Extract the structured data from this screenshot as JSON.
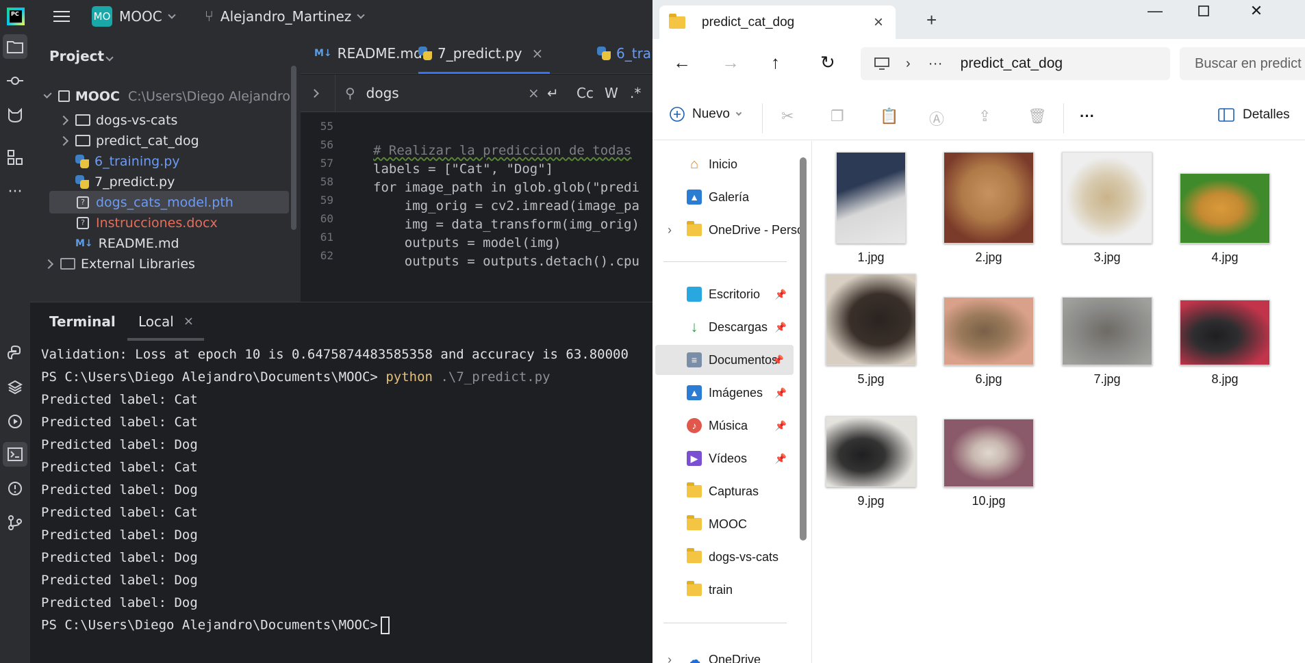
{
  "ide": {
    "project_badge": "MO",
    "project_name": "MOOC",
    "branch": "Alejandro_Martinez",
    "panel_title": "Project",
    "tree": [
      {
        "label": "MOOC",
        "path": "C:\\Users\\Diego Alejandro",
        "type": "folder-open"
      },
      {
        "label": "dogs-vs-cats",
        "type": "folder"
      },
      {
        "label": "predict_cat_dog",
        "type": "folder"
      },
      {
        "label": "6_training.py",
        "type": "py"
      },
      {
        "label": "7_predict.py",
        "type": "py"
      },
      {
        "label": "dogs_cats_model.pth",
        "type": "unknown"
      },
      {
        "label": "Instrucciones.docx",
        "type": "unknown"
      },
      {
        "label": "README.md",
        "type": "md"
      },
      {
        "label": "External Libraries",
        "type": "lib"
      }
    ],
    "editor_tabs": [
      {
        "icon": "M↓",
        "label": "README.md"
      },
      {
        "label": "7_predict.py"
      },
      {
        "label": "6_tra"
      }
    ],
    "search_query": "dogs",
    "search_options": [
      "Cc",
      "W",
      ".*"
    ],
    "code_lines": [
      {
        "n": "55",
        "text": ""
      },
      {
        "n": "56",
        "text": "# Realizar la prediccion de todas"
      },
      {
        "n": "57",
        "text": "labels = [\"Cat\", \"Dog\"]"
      },
      {
        "n": "58",
        "text": "for image_path in glob.glob(\"predi"
      },
      {
        "n": "59",
        "text": "    img_orig = cv2.imread(image_pa"
      },
      {
        "n": "60",
        "text": "    img = data_transform(img_orig)"
      },
      {
        "n": "61",
        "text": "    outputs = model(img)"
      },
      {
        "n": "62",
        "text": "    outputs = outputs.detach().cpu"
      }
    ],
    "terminal": {
      "title": "Terminal",
      "tab": "Local",
      "validation_line": "Validation: Loss at epoch 10 is 0.6475874483585358 and accuracy is 63.80000",
      "prompt": "PS C:\\Users\\Diego Alejandro\\Documents\\MOOC>",
      "command": "python",
      "command_arg": ".\\7_predict.py",
      "outputs": [
        "Predicted label: Cat",
        "Predicted label: Cat",
        "Predicted label: Dog",
        "Predicted label: Cat",
        "Predicted label: Dog",
        "Predicted label: Cat",
        "Predicted label: Dog",
        "Predicted label: Dog",
        "Predicted label: Dog",
        "Predicted label: Dog"
      ],
      "final_prompt": "PS C:\\Users\\Diego Alejandro\\Documents\\MOOC>"
    }
  },
  "explorer": {
    "tab_title": "predict_cat_dog",
    "address": "predict_cat_dog",
    "address_more": "···",
    "search_placeholder": "Buscar en predict",
    "new_label": "Nuevo",
    "details_label": "Detalles",
    "nav": [
      {
        "label": "Inicio",
        "icon": "home-icon",
        "color": "#e67e22"
      },
      {
        "label": "Galería",
        "icon": "gallery-icon",
        "color": "#2b7cd3"
      },
      {
        "label": "OneDrive - Perso",
        "icon": "folder-icon",
        "color": "#f4c542"
      },
      {
        "label": "Escritorio",
        "icon": "desktop-icon",
        "color": "#29a8e0"
      },
      {
        "label": "Descargas",
        "icon": "download-icon",
        "color": "#2ea043"
      },
      {
        "label": "Documentos",
        "icon": "documents-icon",
        "color": "#7a8ea8"
      },
      {
        "label": "Imágenes",
        "icon": "pictures-icon",
        "color": "#2b7cd3"
      },
      {
        "label": "Música",
        "icon": "music-icon",
        "color": "#e2574c"
      },
      {
        "label": "Vídeos",
        "icon": "videos-icon",
        "color": "#7b4fd1"
      },
      {
        "label": "Capturas",
        "icon": "folder-icon",
        "color": "#f4c542"
      },
      {
        "label": "MOOC",
        "icon": "folder-icon",
        "color": "#f4c542"
      },
      {
        "label": "dogs-vs-cats",
        "icon": "folder-icon",
        "color": "#f4c542"
      },
      {
        "label": "train",
        "icon": "folder-icon",
        "color": "#f4c542"
      },
      {
        "label": "OneDrive",
        "icon": "cloud-icon",
        "color": "#1e6fd9"
      }
    ],
    "files": [
      {
        "name": "1.jpg",
        "c1": "#2c3a55",
        "c2": "#d8d8d8"
      },
      {
        "name": "2.jpg",
        "c1": "#7a3b2a",
        "c2": "#c7925f"
      },
      {
        "name": "3.jpg",
        "c1": "#eeeeee",
        "c2": "#c9b38a"
      },
      {
        "name": "4.jpg",
        "c1": "#3f8a2a",
        "c2": "#d99a3a"
      },
      {
        "name": "5.jpg",
        "c1": "#d8cfc2",
        "c2": "#2a2320"
      },
      {
        "name": "6.jpg",
        "c1": "#d9a08a",
        "c2": "#7a6048"
      },
      {
        "name": "7.jpg",
        "c1": "#8a8a88",
        "c2": "#6e6a64"
      },
      {
        "name": "8.jpg",
        "c1": "#c2344a",
        "c2": "#1e1e22"
      },
      {
        "name": "9.jpg",
        "c1": "#e4e2dd",
        "c2": "#1f1f21"
      },
      {
        "name": "10.jpg",
        "c1": "#8b5a6a",
        "c2": "#e0d8d0"
      }
    ]
  }
}
